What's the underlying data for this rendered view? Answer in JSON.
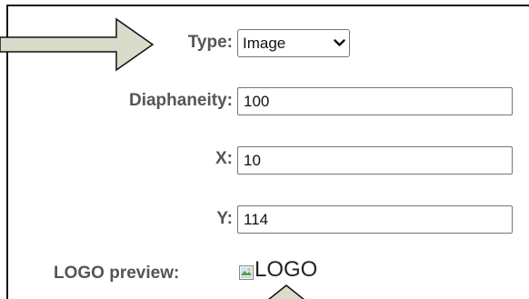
{
  "form": {
    "type": {
      "label": "Type:",
      "selected": "Image"
    },
    "diaphaneity": {
      "label": "Diaphaneity:",
      "value": "100"
    },
    "x": {
      "label": "X:",
      "value": "10"
    },
    "y": {
      "label": "Y:",
      "value": "114"
    },
    "logo_preview": {
      "label": "LOGO preview:",
      "alt_text": "LOGO"
    }
  },
  "annotations": {
    "arrow_color": "#d8dccb",
    "arrow_outline": "#111111"
  }
}
